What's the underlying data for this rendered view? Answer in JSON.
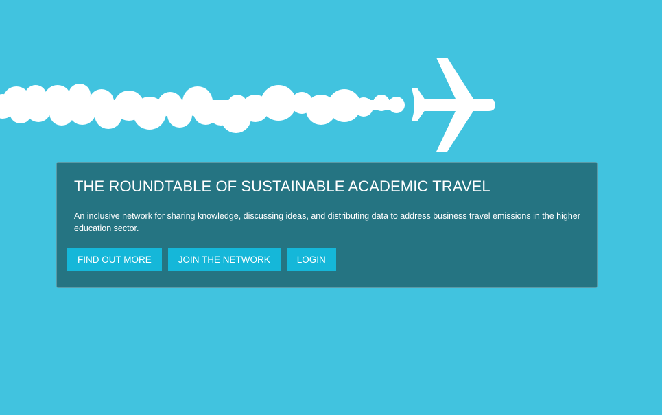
{
  "hero": {
    "title": "THE ROUNDTABLE OF SUSTAINABLE ACADEMIC TRAVEL",
    "description": "An inclusive network for sharing knowledge, discussing ideas, and distributing data to address business travel emissions in the higher education sector.",
    "buttons": [
      {
        "label": "FIND OUT MORE"
      },
      {
        "label": "JOIN THE NETWORK"
      },
      {
        "label": "LOGIN"
      }
    ]
  },
  "illustration": {
    "icons": [
      "airplane-icon",
      "contrail-clouds"
    ]
  },
  "colors": {
    "background": "#41c3df",
    "panel": "#257482",
    "button": "#15b7d9",
    "text": "#ffffff"
  }
}
